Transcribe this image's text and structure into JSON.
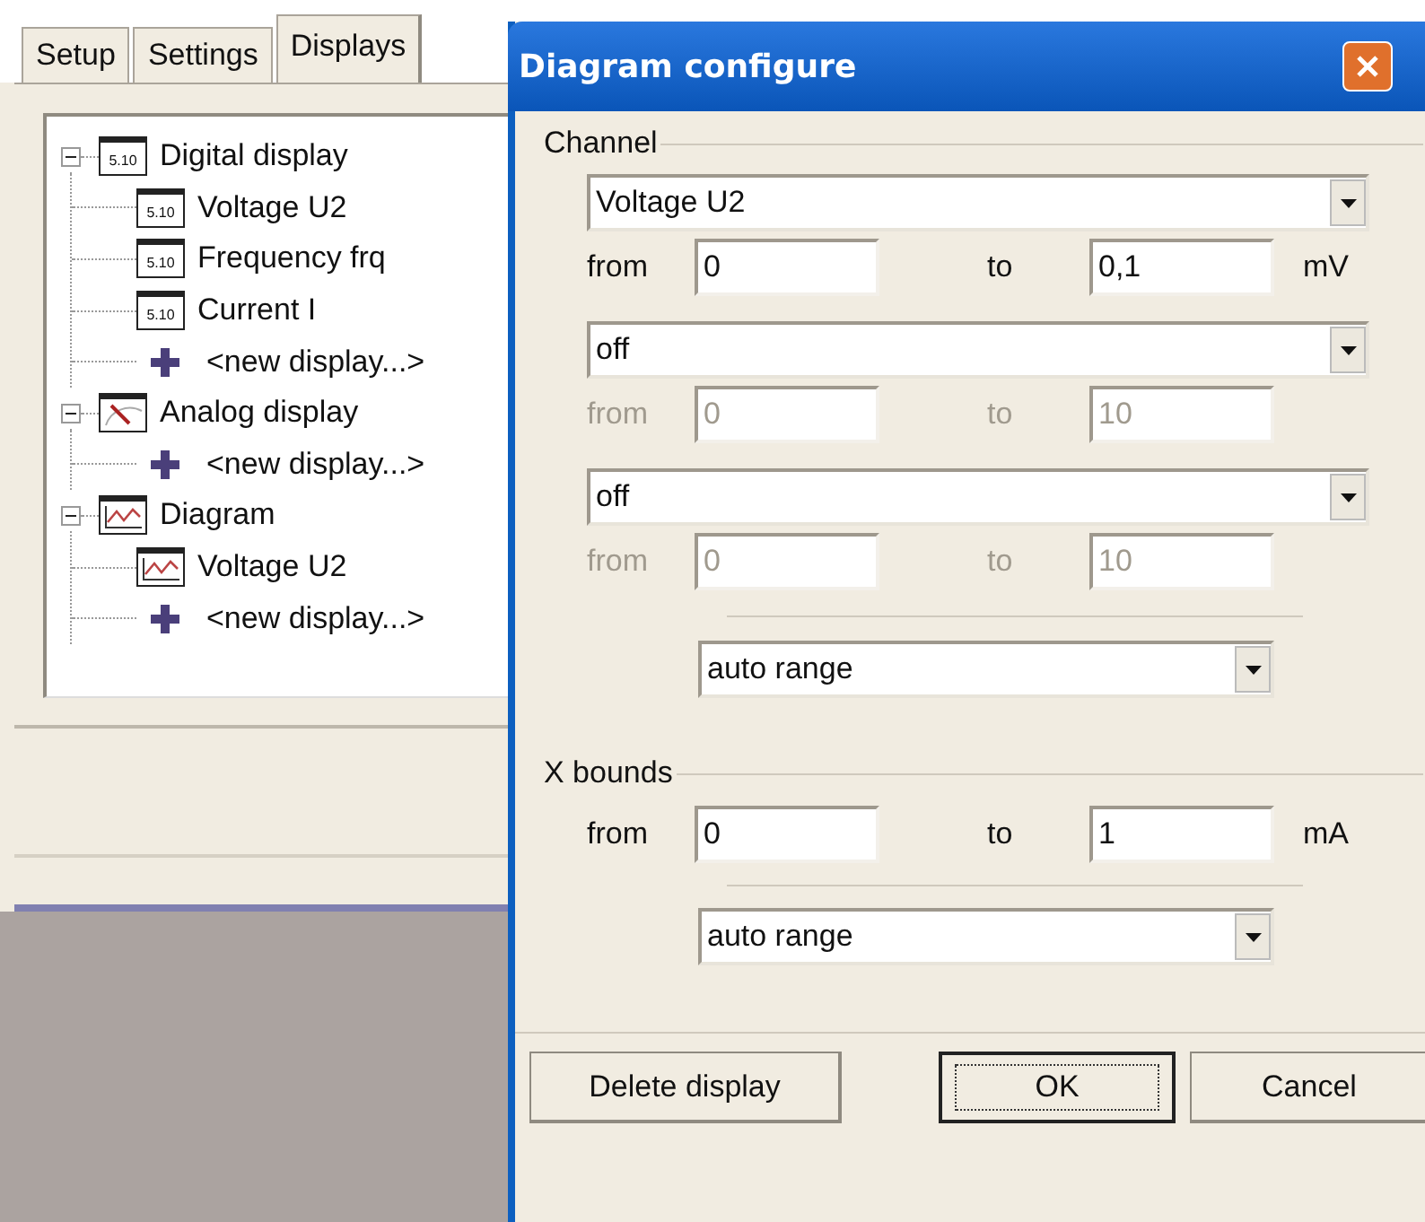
{
  "main_tabs": [
    {
      "label": "Setup",
      "selected": false
    },
    {
      "label": "Settings",
      "selected": false
    },
    {
      "label": "Displays",
      "selected": true
    }
  ],
  "tree": [
    {
      "label": "Digital display",
      "kind": "digital",
      "icon_label": "5.10",
      "expanded": true,
      "children": [
        {
          "label": "Voltage U2",
          "kind": "digital",
          "icon_label": "5.10"
        },
        {
          "label": "Frequency frq",
          "kind": "digital",
          "icon_label": "5.10"
        },
        {
          "label": "Current I",
          "kind": "digital",
          "icon_label": "5.10"
        },
        {
          "label": "<new display...>",
          "kind": "add"
        }
      ]
    },
    {
      "label": "Analog display",
      "kind": "analog",
      "expanded": true,
      "children": [
        {
          "label": "<new display...>",
          "kind": "add"
        }
      ]
    },
    {
      "label": "Diagram",
      "kind": "diagram",
      "expanded": true,
      "children": [
        {
          "label": "Voltage U2",
          "kind": "diagram"
        },
        {
          "label": "<new display...>",
          "kind": "add"
        }
      ]
    }
  ],
  "dialog": {
    "title": "Diagram configure",
    "channel_group": {
      "label": "Channel",
      "channels": [
        {
          "value": "Voltage U2",
          "from_label": "from",
          "from": "0",
          "to_label": "to",
          "to": "0,1",
          "unit": "mV",
          "disabled": false
        },
        {
          "value": "off",
          "from_label": "from",
          "from": "0",
          "to_label": "to",
          "to": "10",
          "disabled": true
        },
        {
          "value": "off",
          "from_label": "from",
          "from": "0",
          "to_label": "to",
          "to": "10",
          "disabled": true
        }
      ],
      "range_mode": "auto range"
    },
    "x_bounds": {
      "label": "X bounds",
      "from_label": "from",
      "from": "0",
      "to_label": "to",
      "to": "1",
      "unit": "mA",
      "range_mode": "auto range"
    },
    "buttons": [
      {
        "label": "Delete display",
        "default": false
      },
      {
        "label": "OK",
        "default": true
      },
      {
        "label": "Cancel",
        "default": false
      }
    ]
  }
}
